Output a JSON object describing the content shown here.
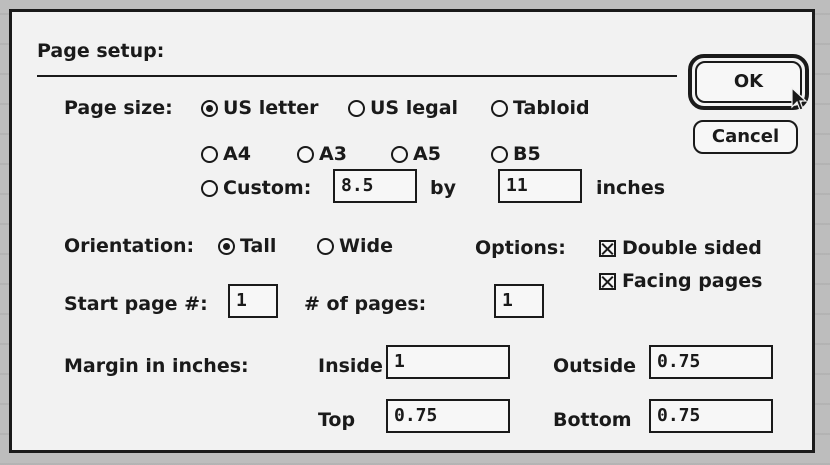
{
  "dialog": {
    "title": "Page setup:",
    "buttons": {
      "ok": "OK",
      "cancel": "Cancel"
    }
  },
  "page_size": {
    "label": "Page size:",
    "options": [
      "US letter",
      "US legal",
      "Tabloid",
      "A4",
      "A3",
      "A5",
      "B5"
    ],
    "selected": "US letter",
    "custom": {
      "label": "Custom:",
      "width": "8.5",
      "by_label": "by",
      "height": "11",
      "unit": "inches"
    }
  },
  "orientation": {
    "label": "Orientation:",
    "options": [
      "Tall",
      "Wide"
    ],
    "selected": "Tall"
  },
  "options": {
    "label": "Options:",
    "double_sided": {
      "label": "Double sided",
      "checked": true
    },
    "facing_pages": {
      "label": "Facing pages",
      "checked": true
    }
  },
  "start_page": {
    "label": "Start page #:",
    "value": "1"
  },
  "num_pages": {
    "label": "# of pages:",
    "value": "1"
  },
  "margins": {
    "label": "Margin in inches:",
    "inside": {
      "label": "Inside",
      "value": "1"
    },
    "outside": {
      "label": "Outside",
      "value": "0.75"
    },
    "top": {
      "label": "Top",
      "value": "0.75"
    },
    "bottom": {
      "label": "Bottom",
      "value": "0.75"
    }
  },
  "icons": {
    "cursor": "arrow-pointer-icon"
  }
}
